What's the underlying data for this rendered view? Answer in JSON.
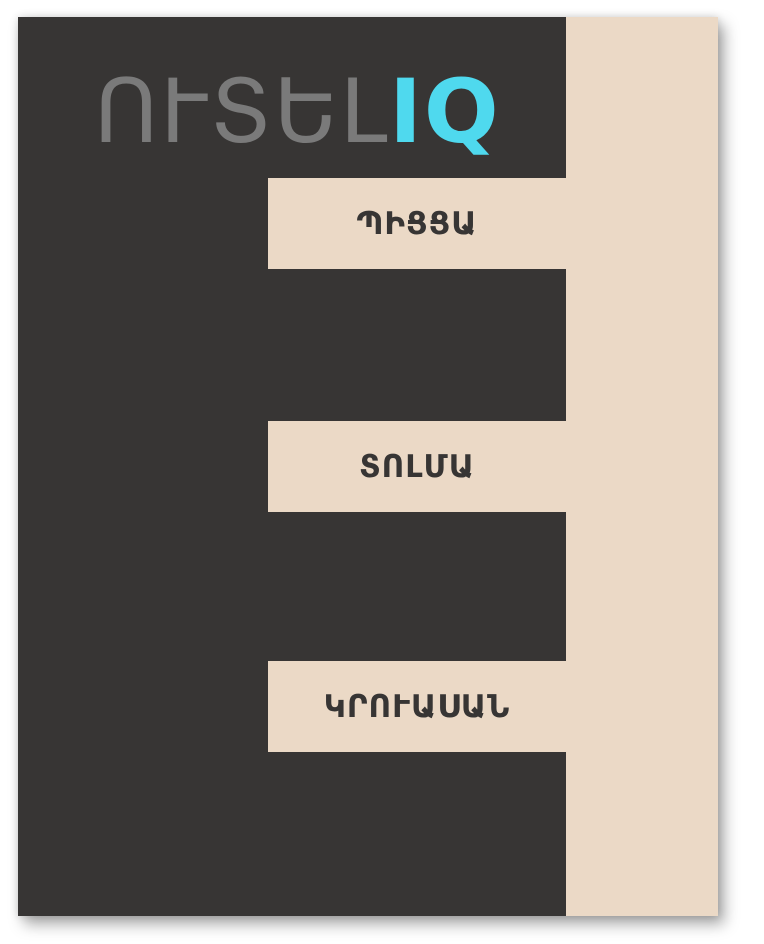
{
  "app": {
    "logo_text": "ՈՒՏԵԼ",
    "logo_accent": "IQ"
  },
  "menu": {
    "items": [
      {
        "label": "ՊԻՑՑԱ"
      },
      {
        "label": "ՏՈԼՄԱ"
      },
      {
        "label": "ԿՐՈՒԱՍԱՆ"
      }
    ]
  },
  "colors": {
    "dark_background": "#373534",
    "light_background": "#ebd9c6",
    "logo_gray": "#7a7a7a",
    "logo_accent": "#4fd9ee",
    "menu_text": "#373534"
  }
}
